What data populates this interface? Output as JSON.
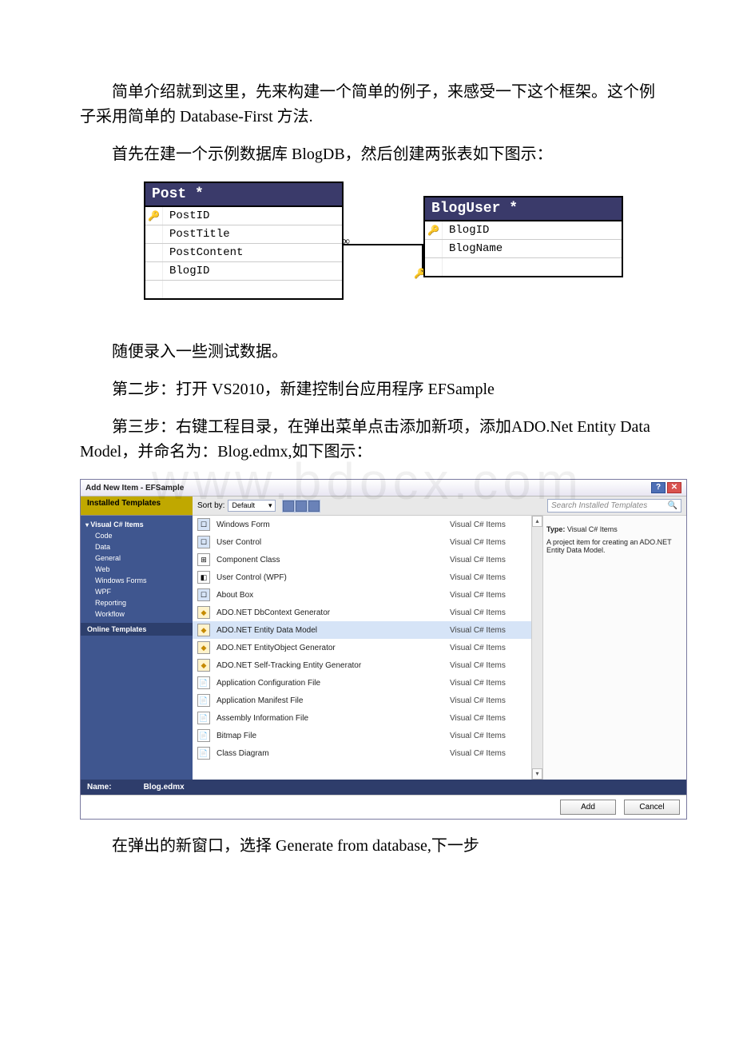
{
  "paragraphs": {
    "p1": "简单介绍就到这里，先来构建一个简单的例子，来感受一下这个框架。这个例子采用简单的 Database-First 方法.",
    "p2": "首先在建一个示例数据库 BlogDB，然后创建两张表如下图示：",
    "p3": "随便录入一些测试数据。",
    "p4": "第二步：打开 VS2010，新建控制台应用程序 EFSample",
    "p5": "第三步：右键工程目录，在弹出菜单点击添加新项，添加ADO.Net Entity Data Model，并命名为：Blog.edmx,如下图示：",
    "p6": "在弹出的新窗口，选择 Generate from database,下一步"
  },
  "db": {
    "post": {
      "title": "Post *",
      "cols": [
        "PostID",
        "PostTitle",
        "PostContent",
        "BlogID"
      ],
      "pk_index": 0
    },
    "bloguser": {
      "title": "BlogUser *",
      "cols": [
        "BlogID",
        "BlogName"
      ],
      "pk_index": 0
    },
    "rel_many_symbol": "∞"
  },
  "watermark": "www.bdocx.com",
  "dialog": {
    "title": "Add New Item - EFSample",
    "tab": "Installed Templates",
    "sort_label": "Sort by:",
    "sort_value": "Default",
    "search_placeholder": "Search Installed Templates",
    "tree": {
      "root": "Visual C# Items",
      "children": [
        "Code",
        "Data",
        "General",
        "Web",
        "Windows Forms",
        "WPF",
        "Reporting",
        "Workflow"
      ],
      "online": "Online Templates"
    },
    "items": [
      {
        "name": "Windows Form",
        "type": "Visual C# Items",
        "icon": "form"
      },
      {
        "name": "User Control",
        "type": "Visual C# Items",
        "icon": "form"
      },
      {
        "name": "Component Class",
        "type": "Visual C# Items",
        "icon": "comp"
      },
      {
        "name": "User Control (WPF)",
        "type": "Visual C# Items",
        "icon": "wpf"
      },
      {
        "name": "About Box",
        "type": "Visual C# Items",
        "icon": "form"
      },
      {
        "name": "ADO.NET DbContext Generator",
        "type": "Visual C# Items",
        "icon": "data"
      },
      {
        "name": "ADO.NET Entity Data Model",
        "type": "Visual C# Items",
        "icon": "data",
        "selected": true
      },
      {
        "name": "ADO.NET EntityObject Generator",
        "type": "Visual C# Items",
        "icon": "data"
      },
      {
        "name": "ADO.NET Self-Tracking Entity Generator",
        "type": "Visual C# Items",
        "icon": "data"
      },
      {
        "name": "Application Configuration File",
        "type": "Visual C# Items",
        "icon": "file"
      },
      {
        "name": "Application Manifest File",
        "type": "Visual C# Items",
        "icon": "file"
      },
      {
        "name": "Assembly Information File",
        "type": "Visual C# Items",
        "icon": "file"
      },
      {
        "name": "Bitmap File",
        "type": "Visual C# Items",
        "icon": "file"
      },
      {
        "name": "Class Diagram",
        "type": "Visual C# Items",
        "icon": "file"
      }
    ],
    "desc_type_label": "Type:",
    "desc_type_value": "Visual C# Items",
    "desc_text": "A project item for creating an ADO.NET Entity Data Model.",
    "name_label": "Name:",
    "name_value": "Blog.edmx",
    "add_btn": "Add",
    "cancel_btn": "Cancel",
    "help_btn": "?",
    "close_btn": "✕",
    "scroll_up": "▴",
    "scroll_down": "▾"
  }
}
